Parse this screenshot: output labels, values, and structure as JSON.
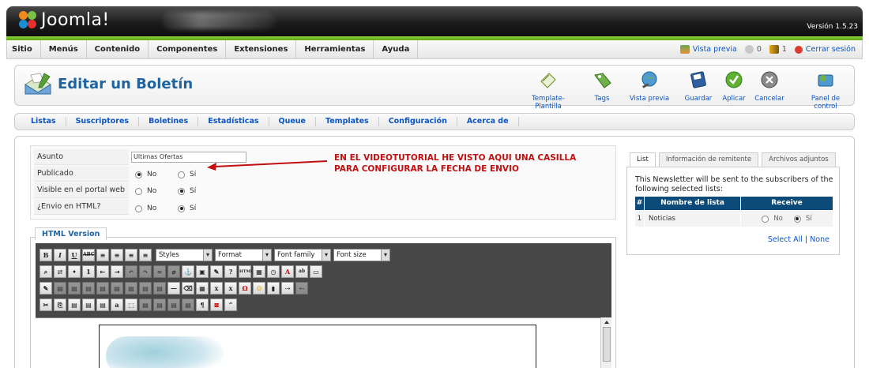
{
  "header": {
    "logo_text": "Joomla!",
    "version": "Versión 1.5.23"
  },
  "menubar": {
    "items": [
      "Sitio",
      "Menús",
      "Contenido",
      "Componentes",
      "Extensiones",
      "Herramientas",
      "Ayuda"
    ],
    "right": {
      "preview": "Vista previa",
      "messages": "0",
      "users": "1",
      "logout": "Cerrar sesión"
    }
  },
  "toolbar": {
    "title": "Editar un Boletín",
    "buttons": [
      "Template-Plantilla",
      "Tags",
      "Vista previa",
      "Guardar",
      "Aplicar",
      "Cancelar",
      "Panel de control"
    ]
  },
  "submenu": {
    "items": [
      "Listas",
      "Suscriptores",
      "Boletines",
      "Estadísticas",
      "Queue",
      "Templates",
      "Configuración",
      "Acerca de"
    ]
  },
  "details": {
    "asunto_label": "Asunto",
    "asunto_value": "Ultimas Ofertas",
    "publicado_label": "Publicado",
    "visible_label": "Visible en el portal web",
    "html_label": "¿Envio en HTML?",
    "no": "No",
    "si": "Sí"
  },
  "annotation": "EN EL VIDEOTUTORIAL HE VISTO AQUI UNA CASILLA PARA CONFIGURAR LA FECHA DE ENVIO",
  "editor": {
    "legend": "HTML Version",
    "selects": [
      "Styles",
      "Format",
      "Font family",
      "Font size"
    ]
  },
  "right_panel": {
    "tabs": [
      "List",
      "Información de remitente",
      "Archivos adjuntos"
    ],
    "description": "This Newsletter will be sent to the subscribers of the following selected lists:",
    "table_headers": [
      "#",
      "Nombre de lista",
      "Receive"
    ],
    "rows": [
      {
        "num": "1",
        "name": "Noticias",
        "no": "No",
        "si": "Sí"
      }
    ],
    "select_all": "Select All",
    "separator": " | ",
    "none": "None"
  }
}
